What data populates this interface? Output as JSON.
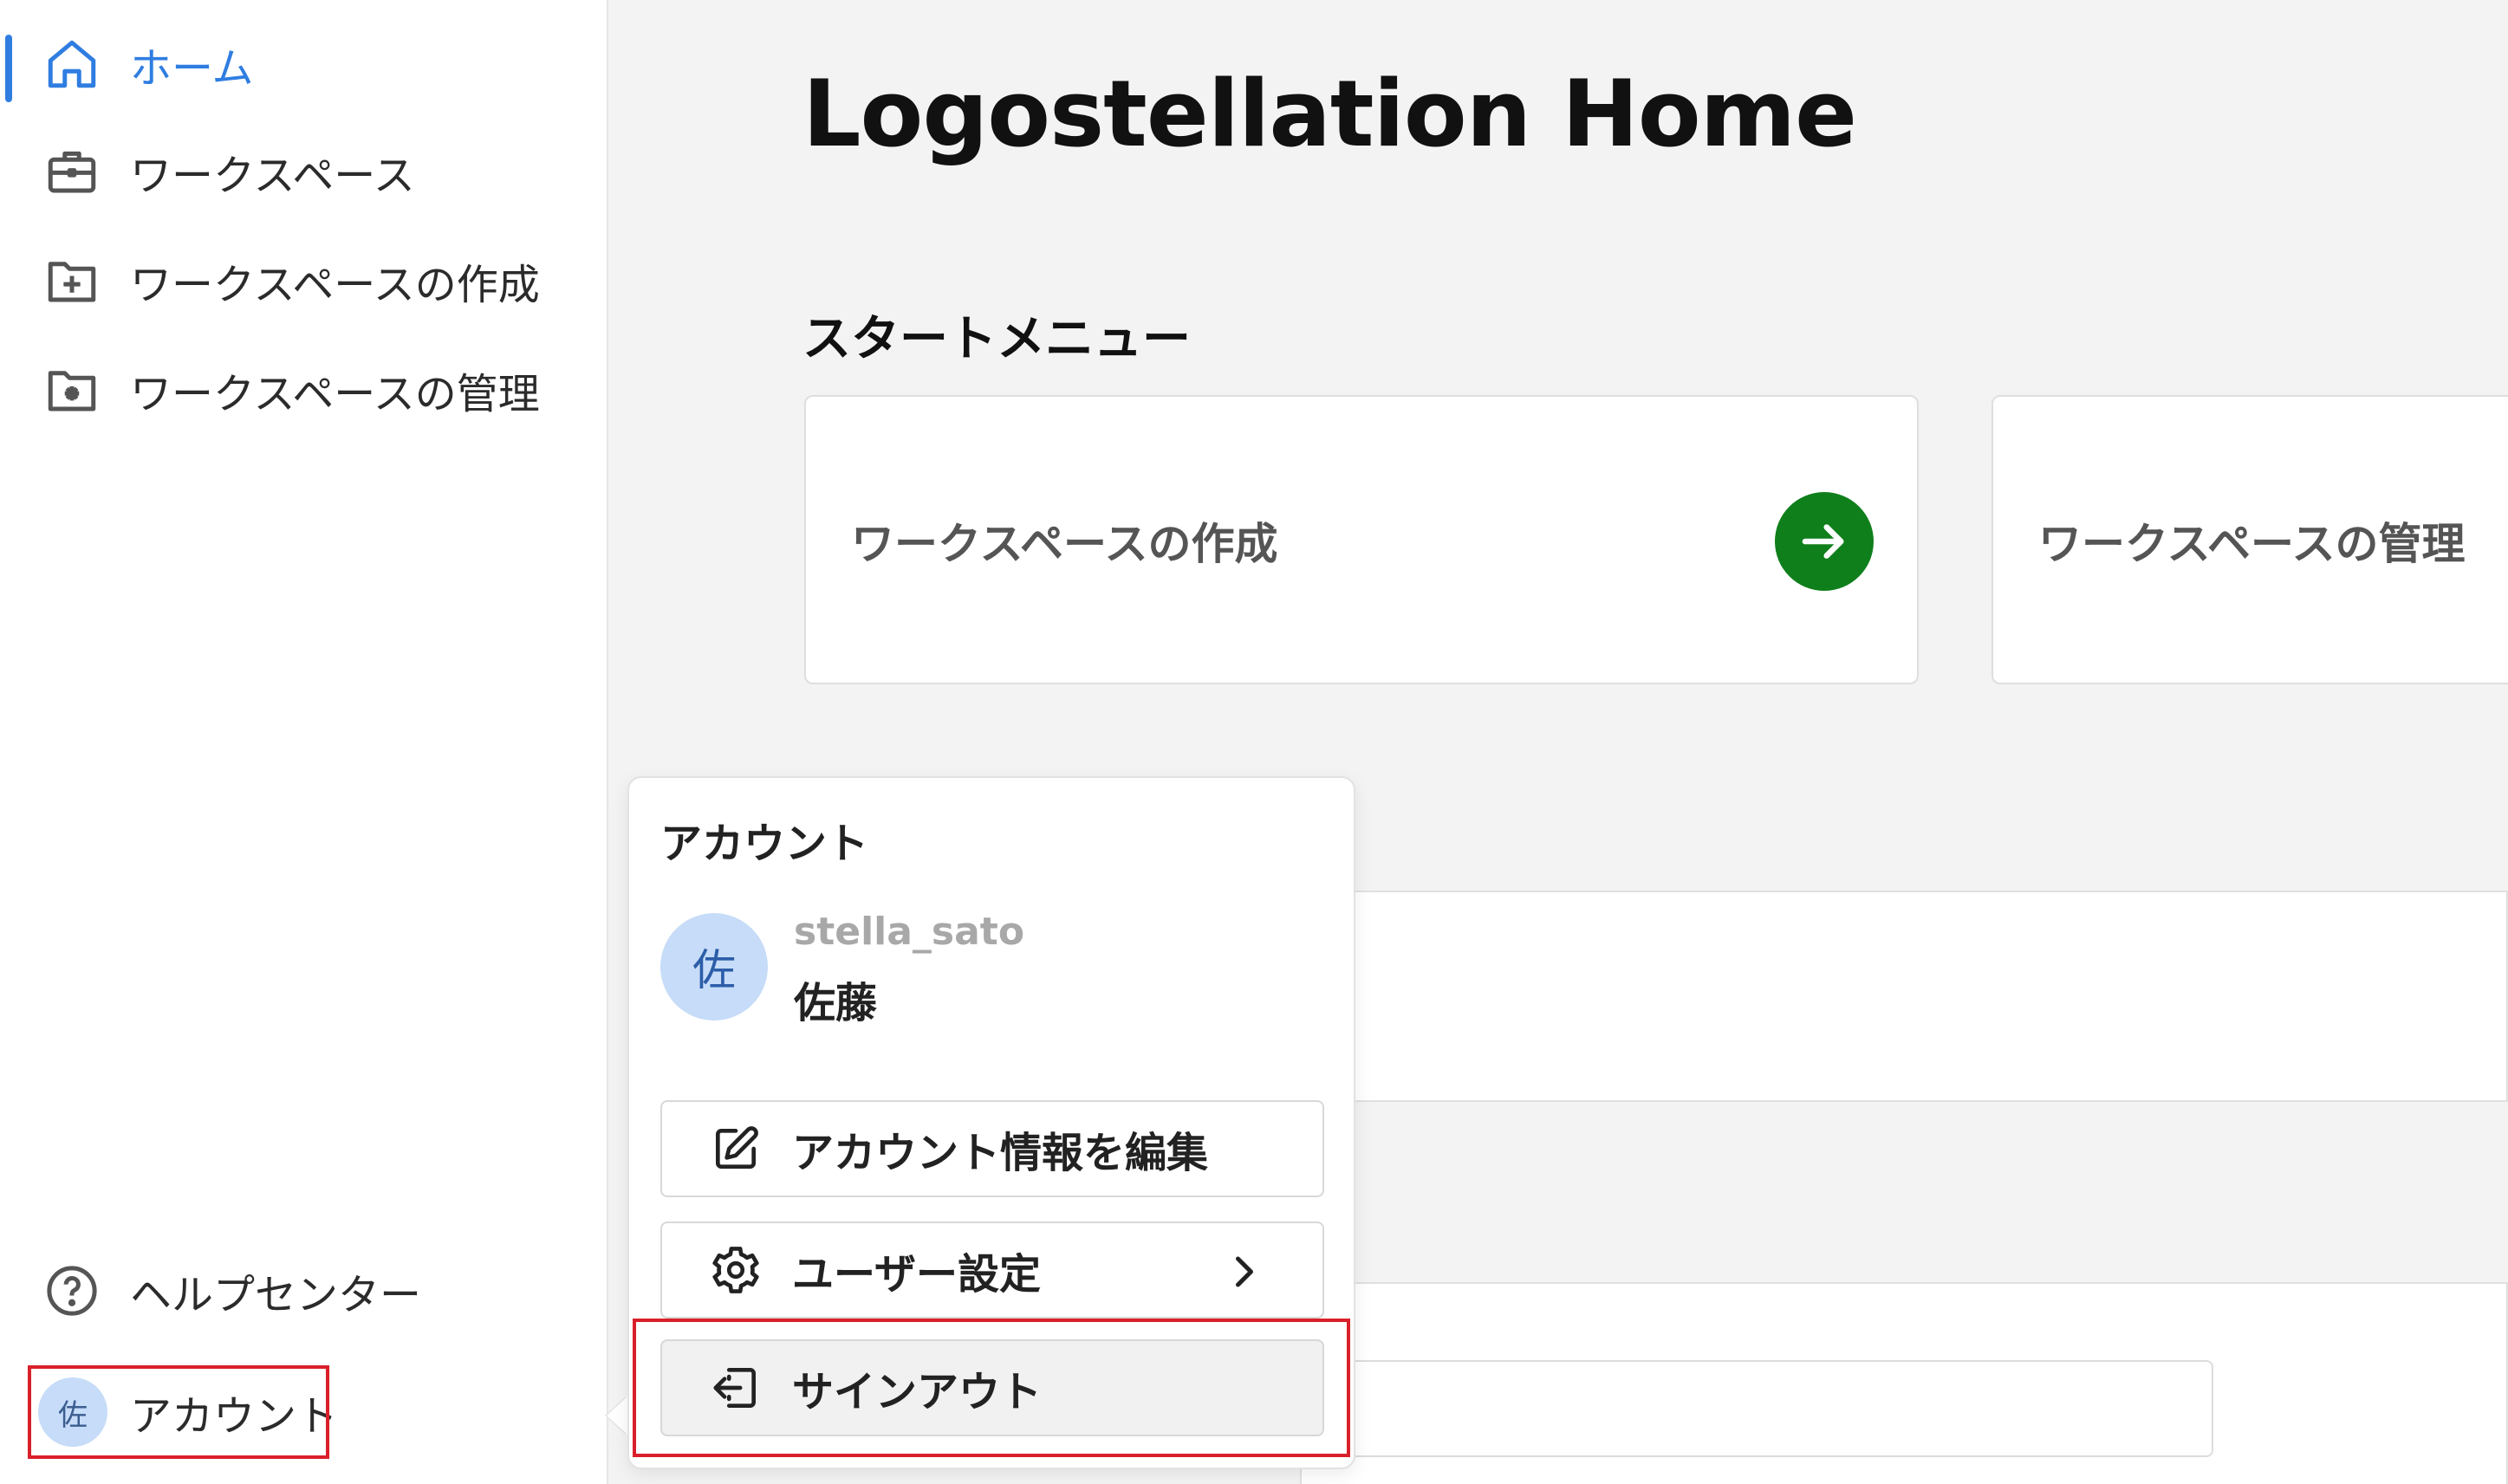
{
  "sidebar": {
    "items": [
      {
        "label": "ホーム",
        "icon": "home-icon",
        "active": true
      },
      {
        "label": "ワークスペース",
        "icon": "briefcase-icon"
      },
      {
        "label": "ワークスペースの作成",
        "icon": "folder-plus-icon"
      },
      {
        "label": "ワークスペースの管理",
        "icon": "folder-gear-icon"
      }
    ],
    "help_label": "ヘルプセンター",
    "account_label": "アカウント",
    "account_avatar": "佐"
  },
  "main": {
    "title": "Logostellation Home",
    "start_menu_title": "スタートメニュー",
    "cards": [
      {
        "label": "ワークスペースの作成"
      },
      {
        "label": "ワークスペースの管理"
      }
    ]
  },
  "account_popover": {
    "title": "アカウント",
    "avatar": "佐",
    "username": "stella_sato",
    "display_name": "佐藤",
    "edit_label": "アカウント情報を編集",
    "settings_label": "ユーザー設定",
    "signout_label": "サインアウト"
  },
  "colors": {
    "accent": "#2f7de1",
    "go_button": "#0f7f1b",
    "highlight": "#d9202a",
    "avatar_bg": "#c6dcf8"
  }
}
